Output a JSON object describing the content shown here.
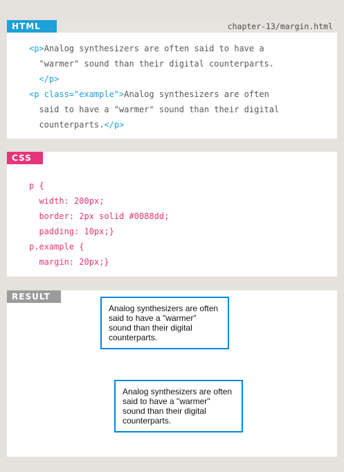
{
  "html_panel": {
    "tag": "HTML",
    "tag_color": "#1ea0d8",
    "filename": "chapter-13/margin.html",
    "lines": [
      {
        "parts": [
          {
            "t": "<p>",
            "c": "blue"
          },
          {
            "t": "Analog synthesizers are often said to have a",
            "c": "plain"
          }
        ]
      },
      {
        "parts": [
          {
            "t": "  \"warmer\" sound than their digital counterparts.",
            "c": "plain"
          }
        ]
      },
      {
        "parts": [
          {
            "t": "  </p>",
            "c": "blue"
          }
        ]
      },
      {
        "parts": [
          {
            "t": "<p class=\"example\">",
            "c": "blue"
          },
          {
            "t": "Analog synthesizers are often",
            "c": "plain"
          }
        ]
      },
      {
        "parts": [
          {
            "t": "  said to have a \"warmer\" sound than their digital",
            "c": "plain"
          }
        ]
      },
      {
        "parts": [
          {
            "t": "  counterparts.",
            "c": "plain"
          },
          {
            "t": "</p>",
            "c": "blue"
          }
        ]
      }
    ]
  },
  "css_panel": {
    "tag": "CSS",
    "tag_color": "#e6357a",
    "lines": [
      "p {",
      "  width: 200px;",
      "  border: 2px solid #0088dd;",
      "  padding: 10px;}",
      "p.example {",
      "  margin: 20px;}"
    ]
  },
  "result_panel": {
    "tag": "RESULT",
    "tag_color": "#9b9b9b",
    "box1_text": "Analog synthesizers are often said to have a \"warmer\" sound than their digital counterparts.",
    "box2_text": "Analog synthesizers are often said to have a \"warmer\" sound than their digital counterparts."
  }
}
